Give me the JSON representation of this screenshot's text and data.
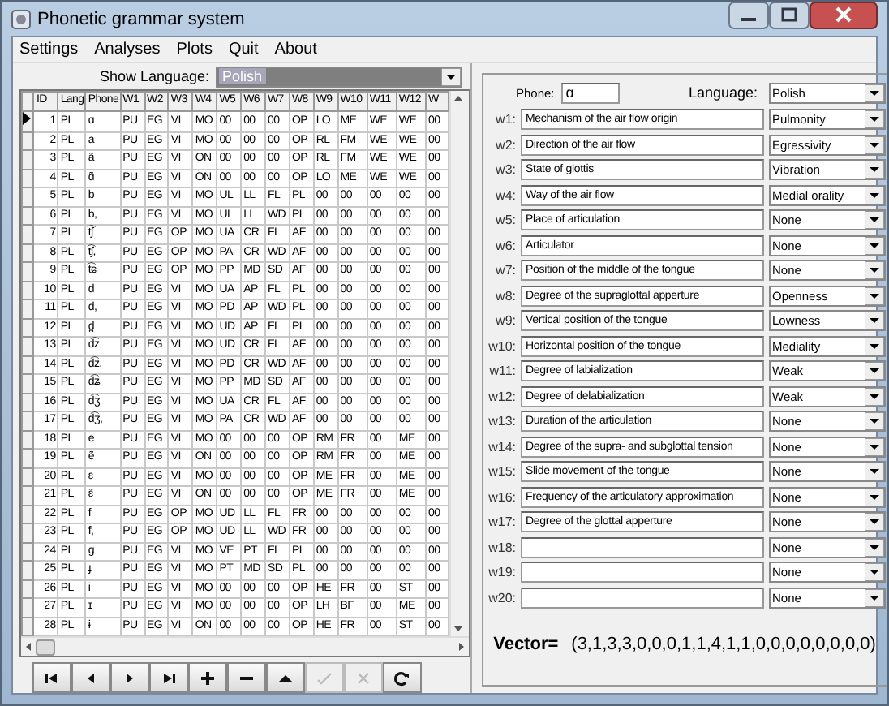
{
  "window": {
    "title": "Phonetic grammar system"
  },
  "menu": [
    "Settings",
    "Analyses",
    "Plots",
    "Quit",
    "About"
  ],
  "show_language": {
    "label": "Show Language:",
    "value": "Polish"
  },
  "table": {
    "columns": [
      "ID",
      "Lang",
      "Phone",
      "W1",
      "W2",
      "W3",
      "W4",
      "W5",
      "W6",
      "W7",
      "W8",
      "W9",
      "W10",
      "W11",
      "W12",
      "W"
    ],
    "rows": [
      {
        "current": true,
        "cells": [
          "1",
          "PL",
          "ɑ",
          "PU",
          "EG",
          "VI",
          "MO",
          "00",
          "00",
          "00",
          "OP",
          "LO",
          "ME",
          "WE",
          "WE",
          "00"
        ]
      },
      {
        "current": false,
        "cells": [
          "2",
          "PL",
          "a",
          "PU",
          "EG",
          "VI",
          "MO",
          "00",
          "00",
          "00",
          "OP",
          "RL",
          "FM",
          "WE",
          "WE",
          "00"
        ]
      },
      {
        "current": false,
        "cells": [
          "3",
          "PL",
          "ã",
          "PU",
          "EG",
          "VI",
          "ON",
          "00",
          "00",
          "00",
          "OP",
          "RL",
          "FM",
          "WE",
          "WE",
          "00"
        ]
      },
      {
        "current": false,
        "cells": [
          "4",
          "PL",
          "ɑ̃",
          "PU",
          "EG",
          "VI",
          "ON",
          "00",
          "00",
          "00",
          "OP",
          "LO",
          "ME",
          "WE",
          "WE",
          "00"
        ]
      },
      {
        "current": false,
        "cells": [
          "5",
          "PL",
          "b",
          "PU",
          "EG",
          "VI",
          "MO",
          "UL",
          "LL",
          "FL",
          "PL",
          "00",
          "00",
          "00",
          "00",
          "00"
        ]
      },
      {
        "current": false,
        "cells": [
          "6",
          "PL",
          "b,",
          "PU",
          "EG",
          "VI",
          "MO",
          "UL",
          "LL",
          "WD",
          "PL",
          "00",
          "00",
          "00",
          "00",
          "00"
        ]
      },
      {
        "current": false,
        "cells": [
          "7",
          "PL",
          "t͡ʃ",
          "PU",
          "EG",
          "OP",
          "MO",
          "UA",
          "CR",
          "FL",
          "AF",
          "00",
          "00",
          "00",
          "00",
          "00"
        ]
      },
      {
        "current": false,
        "cells": [
          "8",
          "PL",
          "t͡ʃ,",
          "PU",
          "EG",
          "OP",
          "MO",
          "PA",
          "CR",
          "WD",
          "AF",
          "00",
          "00",
          "00",
          "00",
          "00"
        ]
      },
      {
        "current": false,
        "cells": [
          "9",
          "PL",
          "t͡ɕ",
          "PU",
          "EG",
          "OP",
          "MO",
          "PP",
          "MD",
          "SD",
          "AF",
          "00",
          "00",
          "00",
          "00",
          "00"
        ]
      },
      {
        "current": false,
        "cells": [
          "10",
          "PL",
          "d",
          "PU",
          "EG",
          "VI",
          "MO",
          "UA",
          "AP",
          "FL",
          "PL",
          "00",
          "00",
          "00",
          "00",
          "00"
        ]
      },
      {
        "current": false,
        "cells": [
          "11",
          "PL",
          "d,",
          "PU",
          "EG",
          "VI",
          "MO",
          "PD",
          "AP",
          "WD",
          "PL",
          "00",
          "00",
          "00",
          "00",
          "00"
        ]
      },
      {
        "current": false,
        "cells": [
          "12",
          "PL",
          "d̪",
          "PU",
          "EG",
          "VI",
          "MO",
          "UD",
          "AP",
          "FL",
          "PL",
          "00",
          "00",
          "00",
          "00",
          "00"
        ]
      },
      {
        "current": false,
        "cells": [
          "13",
          "PL",
          "d͡z",
          "PU",
          "EG",
          "VI",
          "MO",
          "UD",
          "CR",
          "FL",
          "AF",
          "00",
          "00",
          "00",
          "00",
          "00"
        ]
      },
      {
        "current": false,
        "cells": [
          "14",
          "PL",
          "d͡z,",
          "PU",
          "EG",
          "VI",
          "MO",
          "PD",
          "CR",
          "WD",
          "AF",
          "00",
          "00",
          "00",
          "00",
          "00"
        ]
      },
      {
        "current": false,
        "cells": [
          "15",
          "PL",
          "d͡ʑ",
          "PU",
          "EG",
          "VI",
          "MO",
          "PP",
          "MD",
          "SD",
          "AF",
          "00",
          "00",
          "00",
          "00",
          "00"
        ]
      },
      {
        "current": false,
        "cells": [
          "16",
          "PL",
          "d͡ʒ",
          "PU",
          "EG",
          "VI",
          "MO",
          "UA",
          "CR",
          "FL",
          "AF",
          "00",
          "00",
          "00",
          "00",
          "00"
        ]
      },
      {
        "current": false,
        "cells": [
          "17",
          "PL",
          "d͡ʒ,",
          "PU",
          "EG",
          "VI",
          "MO",
          "PA",
          "CR",
          "WD",
          "AF",
          "00",
          "00",
          "00",
          "00",
          "00"
        ]
      },
      {
        "current": false,
        "cells": [
          "18",
          "PL",
          "e",
          "PU",
          "EG",
          "VI",
          "MO",
          "00",
          "00",
          "00",
          "OP",
          "RM",
          "FR",
          "00",
          "ME",
          "00"
        ]
      },
      {
        "current": false,
        "cells": [
          "19",
          "PL",
          "ẽ",
          "PU",
          "EG",
          "VI",
          "ON",
          "00",
          "00",
          "00",
          "OP",
          "RM",
          "FR",
          "00",
          "ME",
          "00"
        ]
      },
      {
        "current": false,
        "cells": [
          "20",
          "PL",
          "ɛ",
          "PU",
          "EG",
          "VI",
          "MO",
          "00",
          "00",
          "00",
          "OP",
          "ME",
          "FR",
          "00",
          "ME",
          "00"
        ]
      },
      {
        "current": false,
        "cells": [
          "21",
          "PL",
          "ɛ̃",
          "PU",
          "EG",
          "VI",
          "ON",
          "00",
          "00",
          "00",
          "OP",
          "ME",
          "FR",
          "00",
          "ME",
          "00"
        ]
      },
      {
        "current": false,
        "cells": [
          "22",
          "PL",
          "f",
          "PU",
          "EG",
          "OP",
          "MO",
          "UD",
          "LL",
          "FL",
          "FR",
          "00",
          "00",
          "00",
          "00",
          "00"
        ]
      },
      {
        "current": false,
        "cells": [
          "23",
          "PL",
          "f,",
          "PU",
          "EG",
          "OP",
          "MO",
          "UD",
          "LL",
          "WD",
          "FR",
          "00",
          "00",
          "00",
          "00",
          "00"
        ]
      },
      {
        "current": false,
        "cells": [
          "24",
          "PL",
          "ɡ",
          "PU",
          "EG",
          "VI",
          "MO",
          "VE",
          "PT",
          "FL",
          "PL",
          "00",
          "00",
          "00",
          "00",
          "00"
        ]
      },
      {
        "current": false,
        "cells": [
          "25",
          "PL",
          "ɟ",
          "PU",
          "EG",
          "VI",
          "MO",
          "PT",
          "MD",
          "SD",
          "PL",
          "00",
          "00",
          "00",
          "00",
          "00"
        ]
      },
      {
        "current": false,
        "cells": [
          "26",
          "PL",
          "i",
          "PU",
          "EG",
          "VI",
          "MO",
          "00",
          "00",
          "00",
          "OP",
          "HE",
          "FR",
          "00",
          "ST",
          "00"
        ]
      },
      {
        "current": false,
        "cells": [
          "27",
          "PL",
          "ɪ",
          "PU",
          "EG",
          "VI",
          "MO",
          "00",
          "00",
          "00",
          "OP",
          "LH",
          "BF",
          "00",
          "ME",
          "00"
        ]
      },
      {
        "current": false,
        "cells": [
          "28",
          "PL",
          "ɨ",
          "PU",
          "EG",
          "VI",
          "ON",
          "00",
          "00",
          "00",
          "OP",
          "HE",
          "FR",
          "00",
          "ST",
          "00"
        ]
      }
    ]
  },
  "navigator": [
    {
      "kind": "first",
      "disabled": false
    },
    {
      "kind": "prior",
      "disabled": false
    },
    {
      "kind": "next",
      "disabled": false
    },
    {
      "kind": "last",
      "disabled": false
    },
    {
      "kind": "insert",
      "disabled": false
    },
    {
      "kind": "delete",
      "disabled": false
    },
    {
      "kind": "edit",
      "disabled": false
    },
    {
      "kind": "post",
      "disabled": true
    },
    {
      "kind": "cancel",
      "disabled": true
    },
    {
      "kind": "refresh",
      "disabled": false
    }
  ],
  "details": {
    "phone_label": "Phone:",
    "phone": "ɑ",
    "language_label": "Language:",
    "language": "Polish",
    "features": [
      {
        "label": "w1:",
        "description": "Mechanism of the air flow origin",
        "value": "Pulmonity"
      },
      {
        "label": "w2:",
        "description": "Direction of the air flow",
        "value": "Egressivity"
      },
      {
        "label": "w3:",
        "description": "State of glottis",
        "value": "Vibration"
      },
      {
        "label": "w4:",
        "description": "Way of the air flow",
        "value": "Medial orality"
      },
      {
        "label": "w5:",
        "description": "Place of articulation",
        "value": "None"
      },
      {
        "label": "w6:",
        "description": "Articulator",
        "value": "None"
      },
      {
        "label": "w7:",
        "description": "Position of the middle of the tongue",
        "value": "None"
      },
      {
        "label": "w8:",
        "description": "Degree of the supraglottal apperture",
        "value": "Openness"
      },
      {
        "label": "w9:",
        "description": "Vertical position of the tongue",
        "value": "Lowness"
      },
      {
        "label": "w10:",
        "description": "Horizontal position of the tongue",
        "value": "Mediality"
      },
      {
        "label": "w11:",
        "description": "Degree of labialization",
        "value": "Weak"
      },
      {
        "label": "w12:",
        "description": "Degree of delabialization",
        "value": "Weak"
      },
      {
        "label": "w13:",
        "description": "Duration of the articulation",
        "value": "None"
      },
      {
        "label": "w14:",
        "description": "Degree of the supra- and subglottal tension",
        "value": "None"
      },
      {
        "label": "w15:",
        "description": "Slide movement of the tongue",
        "value": "None"
      },
      {
        "label": "w16:",
        "description": "Frequency of the articulatory approximation",
        "value": "None"
      },
      {
        "label": "w17:",
        "description": "Degree of the glottal apperture",
        "value": "None"
      },
      {
        "label": "w18:",
        "value": "None"
      },
      {
        "label": "w19:",
        "value": "None"
      },
      {
        "label": "w20:",
        "value": "None"
      }
    ],
    "vector_label": "Vector=",
    "vector": "(3,1,3,3,0,0,0,1,1,4,1,1,0,0,0,0,0,0,0,0)"
  }
}
